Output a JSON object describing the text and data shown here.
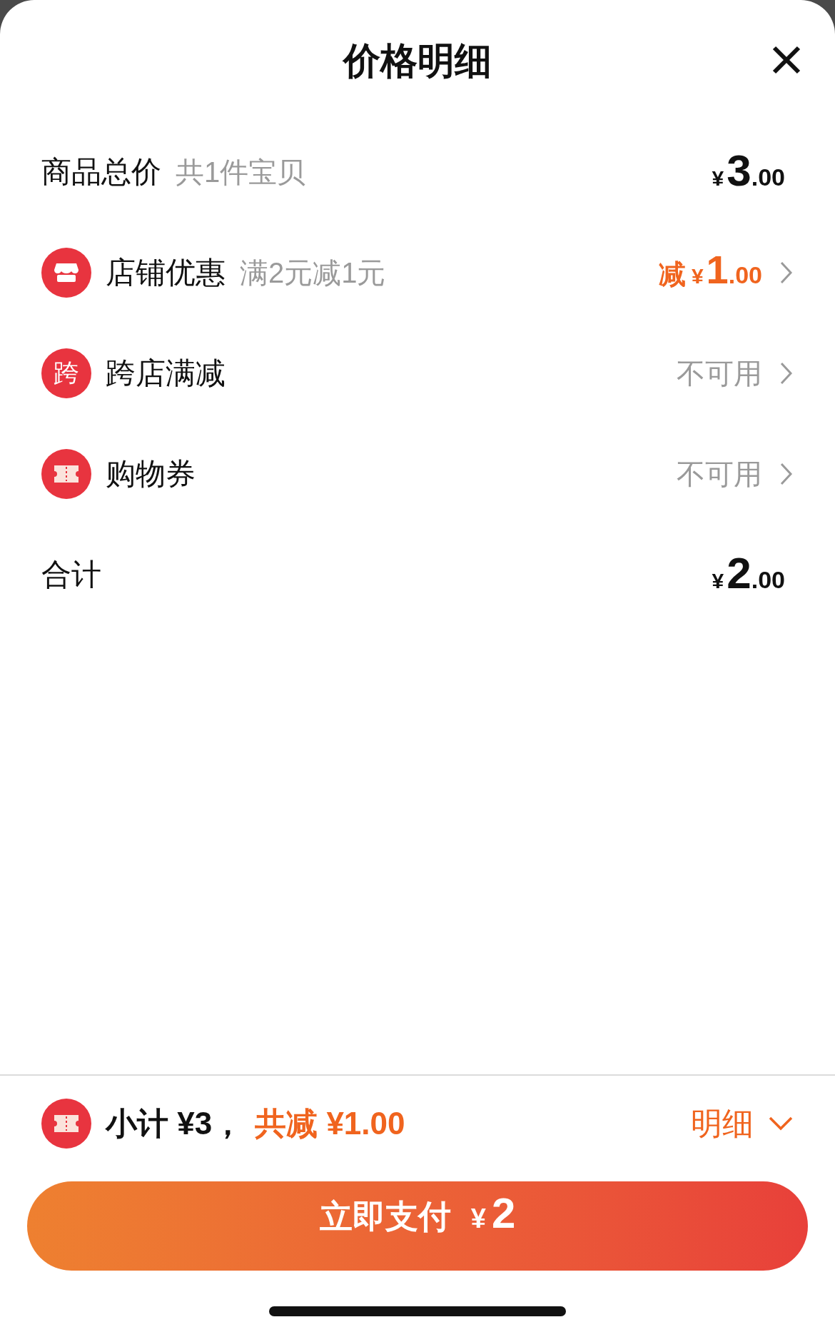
{
  "sheet": {
    "title": "价格明细"
  },
  "rows": [
    {
      "kind": "total",
      "label": "商品总价",
      "note": "共1件宝贝",
      "price": {
        "symbol": "¥",
        "integer": "3",
        "decimal": ".00"
      }
    },
    {
      "kind": "store",
      "label": "店铺优惠",
      "note": "满2元减1元",
      "price": {
        "prefix": "减",
        "symbol": "¥",
        "integer": "1",
        "decimal": ".00"
      }
    },
    {
      "kind": "cross",
      "icon_text": "跨",
      "label": "跨店满减",
      "status": "不可用"
    },
    {
      "kind": "coupon",
      "label": "购物券",
      "status": "不可用"
    },
    {
      "kind": "total",
      "label": "合计",
      "price": {
        "symbol": "¥",
        "integer": "2",
        "decimal": ".00"
      }
    }
  ],
  "footer": {
    "subtotal": "小计 ¥3，",
    "saved": "共减 ¥1.00",
    "details": "明细",
    "expanded": false,
    "pay_button": {
      "label": "立即支付",
      "symbol": "¥",
      "amount": "2"
    }
  }
}
